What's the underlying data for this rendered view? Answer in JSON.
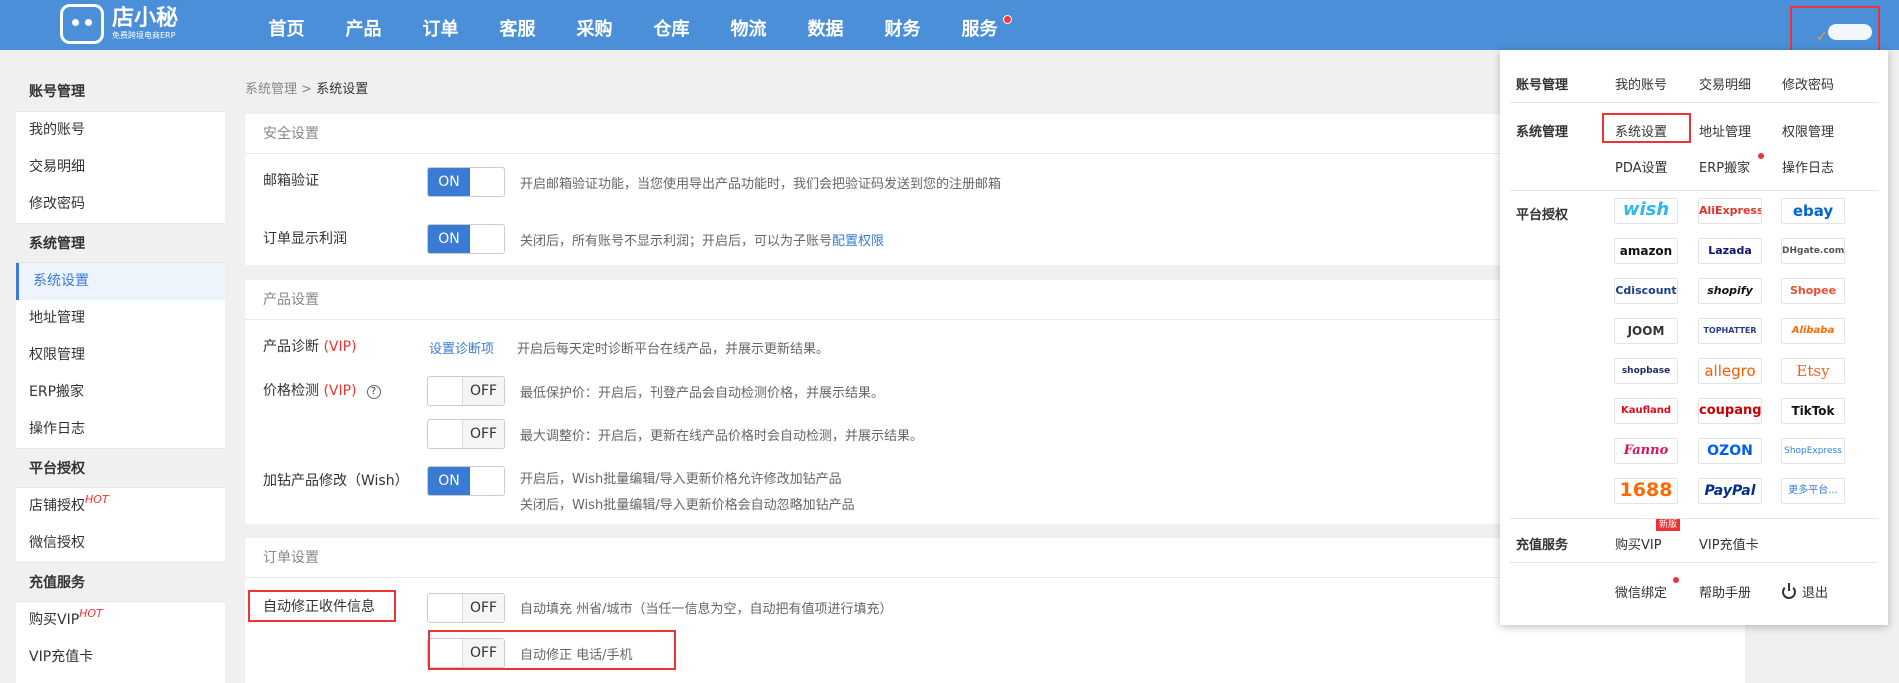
{
  "brand": {
    "name": "店小秘",
    "subtitle": "免费跨境电商ERP"
  },
  "nav": [
    "首页",
    "产品",
    "订单",
    "客服",
    "采购",
    "仓库",
    "物流",
    "数据",
    "财务",
    "服务"
  ],
  "sidebar": {
    "groups": [
      {
        "label": "账号管理",
        "items": [
          "我的账号",
          "交易明细",
          "修改密码"
        ]
      },
      {
        "label": "系统管理",
        "items": [
          "系统设置",
          "地址管理",
          "权限管理",
          "ERP搬家",
          "操作日志"
        ]
      },
      {
        "label": "平台授权",
        "items": [
          "店铺授权",
          "微信授权"
        ]
      },
      {
        "label": "充值服务",
        "items": [
          "购买VIP",
          "VIP充值卡"
        ]
      }
    ],
    "hot": "HOT"
  },
  "breadcrumb": {
    "parent": "系统管理",
    "separator": ">",
    "current": "系统设置"
  },
  "security": {
    "title": "安全设置",
    "email_label": "邮箱验证",
    "email_toggle": "ON",
    "email_desc": "开启邮箱验证功能，当您使用导出产品功能时，我们会把验证码发送到您的注册邮箱",
    "profit_label": "订单显示利润",
    "profit_toggle": "ON",
    "profit_desc": "关闭后，所有账号不显示利润；开启后，可以为子账号",
    "profit_link": "配置权限"
  },
  "product": {
    "title": "产品设置",
    "diag_label": "产品诊断",
    "vip": "(VIP)",
    "diag_link": "设置诊断项",
    "diag_desc": "开启后每天定时诊断平台在线产品，并展示更新结果。",
    "price_label": "价格检测",
    "price_toggle1": "OFF",
    "price_desc1": "最低保护价：开启后，刊登产品会自动检测价格，并展示结果。",
    "price_toggle2": "OFF",
    "price_desc2": "最大调整价：开启后，更新在线产品价格时会自动检测，并展示结果。",
    "wish_label": "加钻产品修改（Wish）",
    "wish_toggle": "ON",
    "wish_desc1": "开启后，Wish批量编辑/导入更新价格允许修改加钻产品",
    "wish_desc2": "关闭后，Wish批量编辑/导入更新价格会自动忽略加钻产品"
  },
  "order": {
    "title": "订单设置",
    "fix_label": "自动修正收件信息",
    "fix_toggle1": "OFF",
    "fix_desc1": "自动填充 州省/城市（当任一信息为空，自动把有值项进行填充）",
    "fix_toggle2": "OFF",
    "fix_desc2": "自动修正 电话/手机"
  },
  "dropdown": {
    "account_label": "账号管理",
    "account_items": [
      "我的账号",
      "交易明细",
      "修改密码"
    ],
    "system_label": "系统管理",
    "system_items": [
      "系统设置",
      "地址管理",
      "权限管理",
      "PDA设置",
      "ERP搬家",
      "操作日志"
    ],
    "platform_label": "平台授权",
    "platforms": [
      "wish",
      "AliExpress",
      "ebay",
      "amazon",
      "Lazada",
      "DHgate.com",
      "Cdiscount",
      "shopify",
      "Shopee",
      "JOOM",
      "TOPHATTER",
      "Alibaba",
      "shopbase",
      "allegro",
      "Etsy",
      "Kaufland",
      "coupang",
      "TikTok",
      "Fanno",
      "OZON",
      "ShopExpress",
      "1688",
      "PayPal",
      "更多平台..."
    ],
    "recharge_label": "充值服务",
    "recharge_items": [
      "购买VIP",
      "VIP充值卡"
    ],
    "new_badge": "新版",
    "bottom_items": [
      "微信绑定",
      "帮助手册",
      "退出"
    ]
  }
}
